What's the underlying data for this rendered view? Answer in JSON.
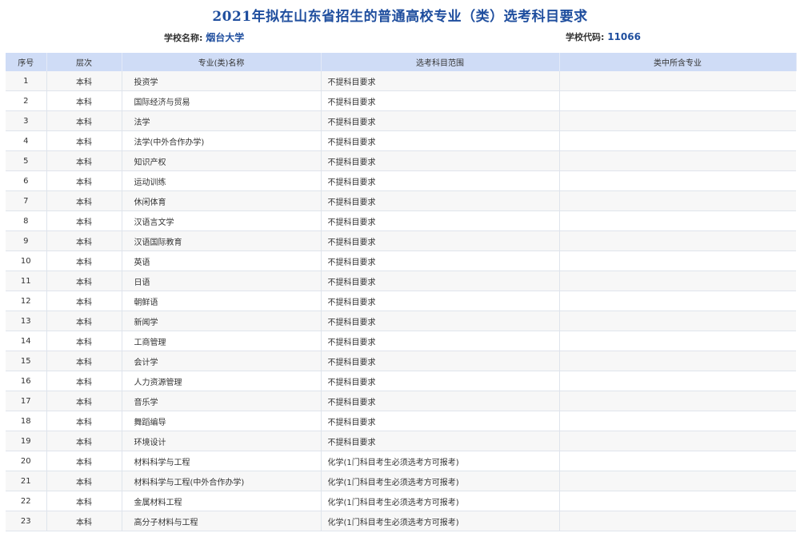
{
  "header": {
    "title": "2021年拟在山东省招生的普通高校专业（类）选考科目要求",
    "school_name_label": "学校名称: ",
    "school_name": "烟台大学",
    "school_code_label": "学校代码: ",
    "school_code": "11066"
  },
  "table": {
    "columns": [
      "序号",
      "层次",
      "专业(类)名称",
      "选考科目范围",
      "类中所含专业"
    ],
    "rows": [
      {
        "index": "1",
        "level": "本科",
        "major": "投资学",
        "requirement": "不提科目要求",
        "sub_majors": ""
      },
      {
        "index": "2",
        "level": "本科",
        "major": "国际经济与贸易",
        "requirement": "不提科目要求",
        "sub_majors": ""
      },
      {
        "index": "3",
        "level": "本科",
        "major": "法学",
        "requirement": "不提科目要求",
        "sub_majors": ""
      },
      {
        "index": "4",
        "level": "本科",
        "major": "法学(中外合作办学)",
        "requirement": "不提科目要求",
        "sub_majors": ""
      },
      {
        "index": "5",
        "level": "本科",
        "major": "知识产权",
        "requirement": "不提科目要求",
        "sub_majors": ""
      },
      {
        "index": "6",
        "level": "本科",
        "major": "运动训练",
        "requirement": "不提科目要求",
        "sub_majors": ""
      },
      {
        "index": "7",
        "level": "本科",
        "major": "休闲体育",
        "requirement": "不提科目要求",
        "sub_majors": ""
      },
      {
        "index": "8",
        "level": "本科",
        "major": "汉语言文学",
        "requirement": "不提科目要求",
        "sub_majors": ""
      },
      {
        "index": "9",
        "level": "本科",
        "major": "汉语国际教育",
        "requirement": "不提科目要求",
        "sub_majors": ""
      },
      {
        "index": "10",
        "level": "本科",
        "major": "英语",
        "requirement": "不提科目要求",
        "sub_majors": ""
      },
      {
        "index": "11",
        "level": "本科",
        "major": "日语",
        "requirement": "不提科目要求",
        "sub_majors": ""
      },
      {
        "index": "12",
        "level": "本科",
        "major": "朝鲜语",
        "requirement": "不提科目要求",
        "sub_majors": ""
      },
      {
        "index": "13",
        "level": "本科",
        "major": "新闻学",
        "requirement": "不提科目要求",
        "sub_majors": ""
      },
      {
        "index": "14",
        "level": "本科",
        "major": "工商管理",
        "requirement": "不提科目要求",
        "sub_majors": ""
      },
      {
        "index": "15",
        "level": "本科",
        "major": "会计学",
        "requirement": "不提科目要求",
        "sub_majors": ""
      },
      {
        "index": "16",
        "level": "本科",
        "major": "人力资源管理",
        "requirement": "不提科目要求",
        "sub_majors": ""
      },
      {
        "index": "17",
        "level": "本科",
        "major": "音乐学",
        "requirement": "不提科目要求",
        "sub_majors": ""
      },
      {
        "index": "18",
        "level": "本科",
        "major": "舞蹈编导",
        "requirement": "不提科目要求",
        "sub_majors": ""
      },
      {
        "index": "19",
        "level": "本科",
        "major": "环境设计",
        "requirement": "不提科目要求",
        "sub_majors": ""
      },
      {
        "index": "20",
        "level": "本科",
        "major": "材料科学与工程",
        "requirement": "化学(1门科目考生必须选考方可报考)",
        "sub_majors": ""
      },
      {
        "index": "21",
        "level": "本科",
        "major": "材料科学与工程(中外合作办学)",
        "requirement": "化学(1门科目考生必须选考方可报考)",
        "sub_majors": ""
      },
      {
        "index": "22",
        "level": "本科",
        "major": "金属材料工程",
        "requirement": "化学(1门科目考生必须选考方可报考)",
        "sub_majors": ""
      },
      {
        "index": "23",
        "level": "本科",
        "major": "高分子材料与工程",
        "requirement": "化学(1门科目考生必须选考方可报考)",
        "sub_majors": ""
      }
    ]
  }
}
